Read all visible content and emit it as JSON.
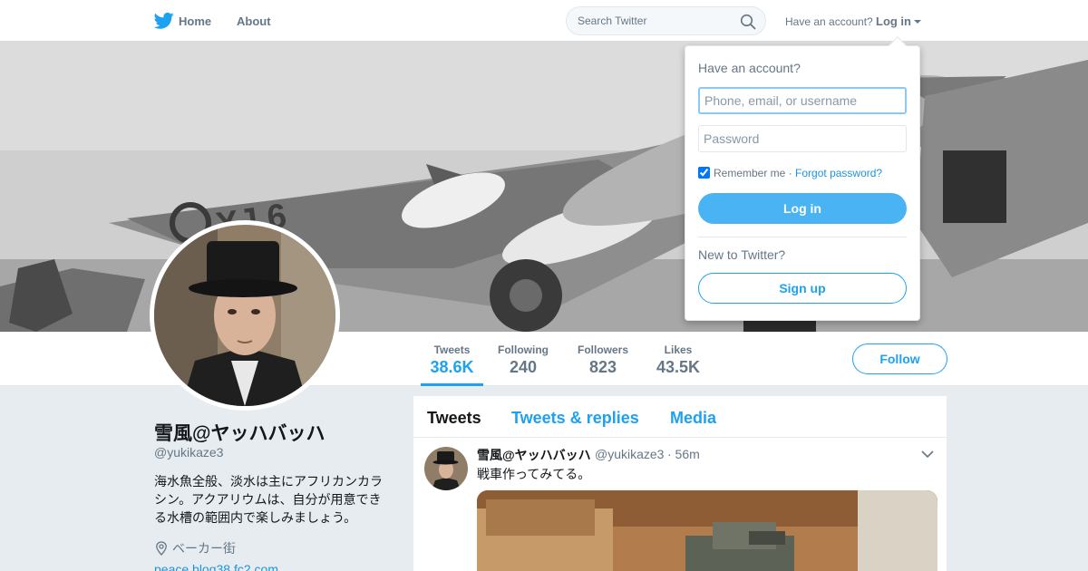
{
  "nav": {
    "home": "Home",
    "about": "About",
    "search_placeholder": "Search Twitter",
    "have_account": "Have an account?",
    "login": "Log in"
  },
  "stats": [
    {
      "label": "Tweets",
      "value": "38.6K"
    },
    {
      "label": "Following",
      "value": "240"
    },
    {
      "label": "Followers",
      "value": "823"
    },
    {
      "label": "Likes",
      "value": "43.5K"
    }
  ],
  "follow_label": "Follow",
  "profile": {
    "name": "雪風@ヤッハバッハ",
    "handle": "@yukikaze3",
    "bio": "海水魚全般、淡水は主にアフリカンカラシン。アクアリウムは、自分が用意できる水槽の範囲内で楽しみましょう。",
    "location": "ベーカー街",
    "url": "peace.blog38.fc2.com"
  },
  "timeline": {
    "tabs": [
      "Tweets",
      "Tweets & replies",
      "Media"
    ],
    "tweet": {
      "name": "雪風@ヤッハバッハ",
      "handle": "@yukikaze3",
      "time": "· 56m",
      "text": "戦車作ってみてる。"
    }
  },
  "login_dropdown": {
    "heading": "Have an account?",
    "username_placeholder": "Phone, email, or username",
    "password_placeholder": "Password",
    "remember_me": "Remember me",
    "separator": "·",
    "forgot_password": "Forgot password?",
    "login_button": "Log in",
    "new_to_twitter": "New to Twitter?",
    "signup_button": "Sign up"
  },
  "colors": {
    "accent": "#1da1f2",
    "login_button_bg": "#4ab3f4",
    "background": "#e6ecf0"
  }
}
